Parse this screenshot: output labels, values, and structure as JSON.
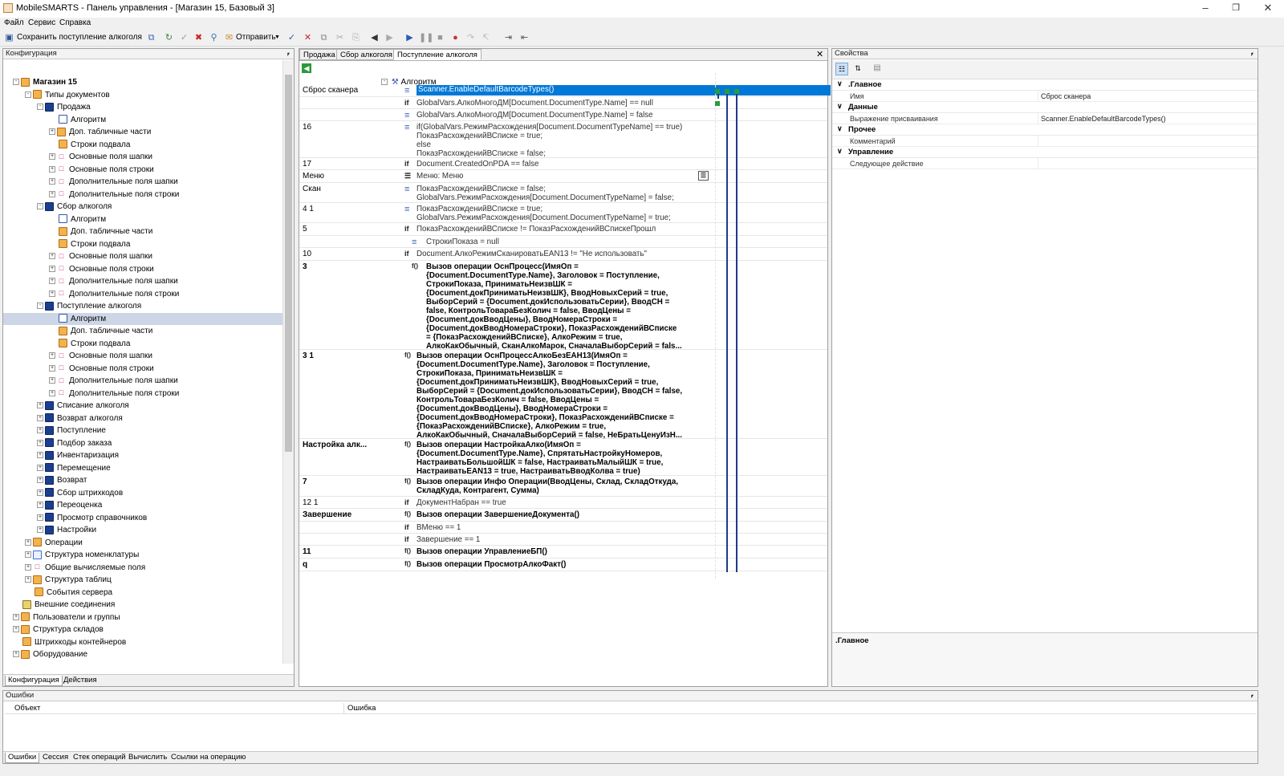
{
  "window": {
    "app": "MobileSMARTS",
    "title": "MobileSMARTS - Панель управления - [Магазин 15, Базовый 3]"
  },
  "menu": [
    "Файл",
    "Сервис",
    "Справка"
  ],
  "toolbar": {
    "save_label": "Сохранить поступление алкоголя",
    "send_label": "Отправить"
  },
  "config_panel": {
    "title": "Конфигурация",
    "tabs": [
      "Конфигурация",
      "Действия"
    ],
    "tree": [
      {
        "label": "Магазин 15",
        "icon": "store-icon",
        "level": 0,
        "exp": "-",
        "bold": true
      },
      {
        "label": "Типы документов",
        "icon": "folder-icon",
        "level": 1,
        "exp": "-"
      },
      {
        "label": "Продажа",
        "icon": "document-type-icon",
        "level": 2,
        "exp": "-"
      },
      {
        "label": "Алгоритм",
        "icon": "algorithm-icon",
        "level": 3,
        "exp": ""
      },
      {
        "label": "Доп. табличные части",
        "icon": "table-icon",
        "level": 3,
        "exp": "+"
      },
      {
        "label": "Строки подвала",
        "icon": "table-icon",
        "level": 3,
        "exp": ""
      },
      {
        "label": "Основные поля шапки",
        "icon": "field-icon",
        "level": 3,
        "exp": "+"
      },
      {
        "label": "Основные поля строки",
        "icon": "field-icon",
        "level": 3,
        "exp": "+"
      },
      {
        "label": "Дополнительные поля шапки",
        "icon": "field-icon",
        "level": 3,
        "exp": "+"
      },
      {
        "label": "Дополнительные поля строки",
        "icon": "field-icon",
        "level": 3,
        "exp": "+"
      },
      {
        "label": "Сбор алкоголя",
        "icon": "document-type-icon",
        "level": 2,
        "exp": "-"
      },
      {
        "label": "Алгоритм",
        "icon": "algorithm-icon",
        "level": 3,
        "exp": ""
      },
      {
        "label": "Доп. табличные части",
        "icon": "table-icon",
        "level": 3,
        "exp": ""
      },
      {
        "label": "Строки подвала",
        "icon": "table-icon",
        "level": 3,
        "exp": ""
      },
      {
        "label": "Основные поля шапки",
        "icon": "field-icon",
        "level": 3,
        "exp": "+"
      },
      {
        "label": "Основные поля строки",
        "icon": "field-icon",
        "level": 3,
        "exp": "+"
      },
      {
        "label": "Дополнительные поля шапки",
        "icon": "field-icon",
        "level": 3,
        "exp": "+"
      },
      {
        "label": "Дополнительные поля строки",
        "icon": "field-icon",
        "level": 3,
        "exp": "+"
      },
      {
        "label": "Поступление алкоголя",
        "icon": "document-type-icon",
        "level": 2,
        "exp": "-"
      },
      {
        "label": "Алгоритм",
        "icon": "algorithm-icon",
        "level": 3,
        "exp": "",
        "selected": true
      },
      {
        "label": "Доп. табличные части",
        "icon": "table-icon",
        "level": 3,
        "exp": ""
      },
      {
        "label": "Строки подвала",
        "icon": "table-icon",
        "level": 3,
        "exp": ""
      },
      {
        "label": "Основные поля шапки",
        "icon": "field-icon",
        "level": 3,
        "exp": "+"
      },
      {
        "label": "Основные поля строки",
        "icon": "field-icon",
        "level": 3,
        "exp": "+"
      },
      {
        "label": "Дополнительные поля шапки",
        "icon": "field-icon",
        "level": 3,
        "exp": "+"
      },
      {
        "label": "Дополнительные поля строки",
        "icon": "field-icon",
        "level": 3,
        "exp": "+"
      },
      {
        "label": "Списание алкоголя",
        "icon": "document-type-icon",
        "level": 2,
        "exp": "+"
      },
      {
        "label": "Возврат алкоголя",
        "icon": "document-type-icon",
        "level": 2,
        "exp": "+"
      },
      {
        "label": "Поступление",
        "icon": "document-type-icon",
        "level": 2,
        "exp": "+"
      },
      {
        "label": "Подбор заказа",
        "icon": "document-type-icon",
        "level": 2,
        "exp": "+"
      },
      {
        "label": "Инвентаризация",
        "icon": "document-type-icon",
        "level": 2,
        "exp": "+"
      },
      {
        "label": "Перемещение",
        "icon": "document-type-icon",
        "level": 2,
        "exp": "+"
      },
      {
        "label": "Возврат",
        "icon": "document-type-icon",
        "level": 2,
        "exp": "+"
      },
      {
        "label": "Сбор штрихкодов",
        "icon": "document-type-icon",
        "level": 2,
        "exp": "+"
      },
      {
        "label": "Переоценка",
        "icon": "document-type-icon",
        "level": 2,
        "exp": "+"
      },
      {
        "label": "Просмотр справочников",
        "icon": "document-type-icon",
        "level": 2,
        "exp": "+"
      },
      {
        "label": "Настройки",
        "icon": "document-type-icon",
        "level": 2,
        "exp": "+"
      },
      {
        "label": "Операции",
        "icon": "folder-icon",
        "level": 1,
        "exp": "+"
      },
      {
        "label": "Структура номенклатуры",
        "icon": "grid-icon",
        "level": 1,
        "exp": "+"
      },
      {
        "label": "Общие вычисляемые поля",
        "icon": "field-icon",
        "level": 1,
        "exp": "+"
      },
      {
        "label": "Структура таблиц",
        "icon": "table-icon",
        "level": 1,
        "exp": "+"
      },
      {
        "label": "События сервера",
        "icon": "table-icon",
        "level": 1,
        "exp": ""
      },
      {
        "label": "Внешние соединения",
        "icon": "plug-icon",
        "level": 0,
        "exp": ""
      },
      {
        "label": "Пользователи и группы",
        "icon": "users-icon",
        "level": 0,
        "exp": "+"
      },
      {
        "label": "Структура складов",
        "icon": "folder-icon",
        "level": 0,
        "exp": "+"
      },
      {
        "label": "Штрихкоды контейнеров",
        "icon": "folder-icon",
        "level": 0,
        "exp": ""
      },
      {
        "label": "Оборудование",
        "icon": "folder-icon",
        "level": 0,
        "exp": "+"
      }
    ]
  },
  "editor": {
    "tabs": [
      "Продажа",
      "Сбор алкоголя",
      "Поступление алкоголя"
    ],
    "active_tab": 2,
    "root_label": "Алгоритм",
    "rows": [
      {
        "label": "Сброс сканера",
        "icon": "assign",
        "code": "Scanner.EnableDefaultBarcodeTypes()",
        "selected": true
      },
      {
        "label": "",
        "icon": "if",
        "code": "GlobalVars.АлкоМногоДМ[Document.DocumentType.Name] == null"
      },
      {
        "label": "",
        "icon": "assign",
        "code": "GlobalVars.АлкоМногоДМ[Document.DocumentType.Name] = false"
      },
      {
        "label": "16",
        "icon": "assign",
        "code": "if(GlobalVars.РежимРасхождения[Document.DocumentTypeName] == true)\nПоказРасхожденийВСписке = true;\nelse\nПоказРасхожденийВСписке = false;"
      },
      {
        "label": "17",
        "icon": "if",
        "code": "Document.CreatedOnPDA == false"
      },
      {
        "label": "Меню",
        "icon": "menu",
        "code": "Меню: Меню"
      },
      {
        "label": "Скан",
        "icon": "assign",
        "code": "ПоказРасхожденийВСписке = false;\nGlobalVars.РежимРасхождения[Document.DocumentTypeName] = false;"
      },
      {
        "label": "4 1",
        "icon": "assign",
        "code": "ПоказРасхожденийВСписке = true;\nGlobalVars.РежимРасхождения[Document.DocumentTypeName] = true;"
      },
      {
        "label": "5",
        "icon": "if",
        "code": "ПоказРасхожденийВСписке != ПоказРасхожденийВСпискеПрошл"
      },
      {
        "label": "",
        "icon": "assign",
        "code": "СтрокиПоказа = null",
        "indent": true
      },
      {
        "label": "10",
        "icon": "if",
        "code": "Document.АлкоРежимСканироватьEAN13 != \"Не использовать\""
      },
      {
        "label": "3",
        "icon": "func",
        "code": "Вызов операции ОснПроцесс(ИмяОп =\n{Document.DocumentType.Name}, Заголовок = Поступление,\nСтрокиПоказа, ПриниматьНеизвШК =\n{Document.докПриниматьНеизвШК}, ВводНовыхСерий = true,\nВыборСерий = {Document.докИспользоватьСерии}, ВводСН =\nfalse, КонтрольТовараБезКолич = false, ВводЦены =\n{Document.докВводЦены}, ВводНомераСтроки =\n{Document.докВводНомераСтроки}, ПоказРасхожденийВСписке\n= {ПоказРасхожденийВСписке}, АлкоРежим = true,\nАлкоКакОбычный, СканАлкоМарок, СначалаВыборСерий = fals...",
        "bold": true,
        "indent": true
      },
      {
        "label": "3 1",
        "icon": "func",
        "code": "Вызов операции ОснПроцессАлкоБезЕАН13(ИмяОп =\n{Document.DocumentType.Name}, Заголовок = Поступление,\nСтрокиПоказа, ПриниматьНеизвШК =\n{Document.докПриниматьНеизвШК}, ВводНовыхСерий = true,\nВыборСерий = {Document.докИспользоватьСерии}, ВводСН = false,\nКонтрольТовараБезКолич = false, ВводЦены =\n{Document.докВводЦены}, ВводНомераСтроки =\n{Document.докВводНомераСтроки}, ПоказРасхожденийВСписке =\n{ПоказРасхожденийВСписке}, АлкоРежим = true,\nАлкоКакОбычный, СначалаВыборСерий = false, НеБратьЦенуИзН...",
        "bold": true
      },
      {
        "label": "Настройка алк...",
        "icon": "func",
        "code": "Вызов операции НастройкаАлко(ИмяОп =\n{Document.DocumentType.Name}, СпрятатьНастройкуНомеров,\nНастраиватьБольшойШК = false, НастраиватьМалыйШК = true,\nНастраиватьEAN13 = true, НастраиватьВводКолва = true)",
        "bold": true
      },
      {
        "label": "7",
        "icon": "func",
        "code": "Вызов операции Инфо Операции(ВводЦены, Склад, СкладОткуда,\nСкладКуда, Контрагент, Сумма)",
        "bold": true
      },
      {
        "label": "12 1",
        "icon": "if",
        "code": "ДокументНабран == true"
      },
      {
        "label": "Завершение",
        "icon": "func",
        "code": "Вызов операции ЗавершениеДокумента()",
        "bold": true
      },
      {
        "label": "",
        "icon": "if",
        "code": "ВМеню == 1"
      },
      {
        "label": "",
        "icon": "if",
        "code": "Завершение == 1"
      },
      {
        "label": "11",
        "icon": "func",
        "code": "Вызов операции УправлениеБП()",
        "bold": true
      },
      {
        "label": "q",
        "icon": "func",
        "code": "Вызов операции ПросмотрАлкоФакт()",
        "bold": true
      }
    ]
  },
  "properties": {
    "title": "Свойства",
    "sections": [
      {
        "name": ".Главное",
        "rows": [
          {
            "k": "Имя",
            "v": "Сброс сканера"
          }
        ]
      },
      {
        "name": "Данные",
        "rows": [
          {
            "k": "Выражение присваивания",
            "v": "Scanner.EnableDefaultBarcodeTypes()"
          }
        ]
      },
      {
        "name": "Прочее",
        "rows": [
          {
            "k": "Комментарий",
            "v": ""
          }
        ]
      },
      {
        "name": "Управление",
        "rows": [
          {
            "k": "Следующее действие",
            "v": ""
          }
        ]
      }
    ],
    "description_title": ".Главное"
  },
  "errors_panel": {
    "title": "Ошибки",
    "columns": [
      "Объект",
      "Ошибка"
    ],
    "tabs": [
      "Ошибки",
      "Сессия",
      "Стек операций",
      "Вычислить",
      "Ссылки на операцию"
    ]
  },
  "colors": {
    "selection": "#0078d7",
    "tree_selection": "#ccd6e6",
    "doc_icon": "#1b3f8e",
    "folder_icon": "#f2b24c"
  }
}
